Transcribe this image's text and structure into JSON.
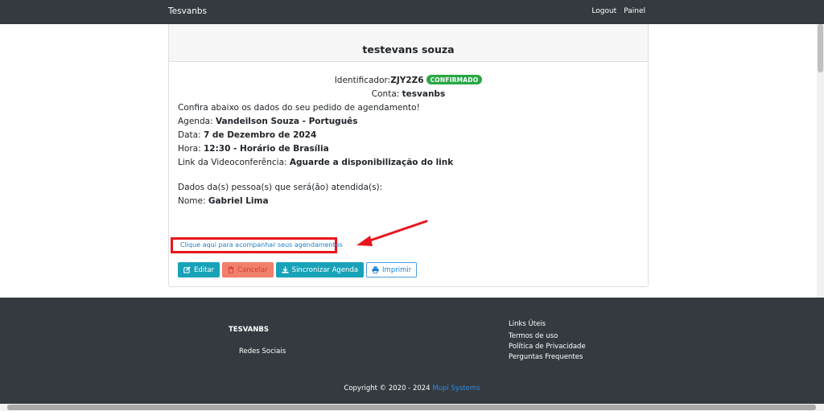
{
  "navbar": {
    "brand": "Tesvanbs",
    "links": [
      "Logout",
      "Painel"
    ]
  },
  "card": {
    "title": "testevans souza",
    "identifier_label": "Identificador:",
    "identifier_value": "ZJY2Z6",
    "status_badge": "CONFIRMADO",
    "account_label": "Conta: ",
    "account_value": "tesvanbs",
    "intro": "Confira abaixo os dados do seu pedido de agendamento!",
    "agenda_label": "Agenda: ",
    "agenda_value": "Vandeilson Souza - Português",
    "date_label": "Data: ",
    "date_value": "7 de Dezembro de 2024",
    "time_label": "Hora: ",
    "time_value": "12:30 - Horário de Brasília",
    "video_label": "Link da Videoconferência: ",
    "video_value": "Aguarde a disponibilização do link",
    "people_heading": "Dados da(s) pessoa(s) que será(ão) atendida(s):",
    "name_label": "Nome: ",
    "name_value": "Gabriel Lima",
    "track_link": "Clique aqui para acompanhar seus agendamentos",
    "buttons": {
      "edit": "Editar",
      "cancel": "Cancelar",
      "sync": "Sincronizar Agenda",
      "print": "Imprimir"
    }
  },
  "footer": {
    "brand": "TESVANBS",
    "social": "Redes Sociais",
    "links_title": "Links Úteis",
    "links": [
      "Termos de uso",
      "Política de Privacidade",
      "Perguntas Frequentes"
    ],
    "copyright": "Copyright © 2020 - 2024 ",
    "company": "Mupi Systems"
  },
  "colors": {
    "navbar": "#343a40",
    "confirmed": "#28a745",
    "info": "#17a2b8",
    "highlight_box": "#e8161c"
  },
  "icons": {
    "edit": "edit-icon",
    "cancel": "trash-icon",
    "sync": "download-icon",
    "print": "print-icon"
  }
}
